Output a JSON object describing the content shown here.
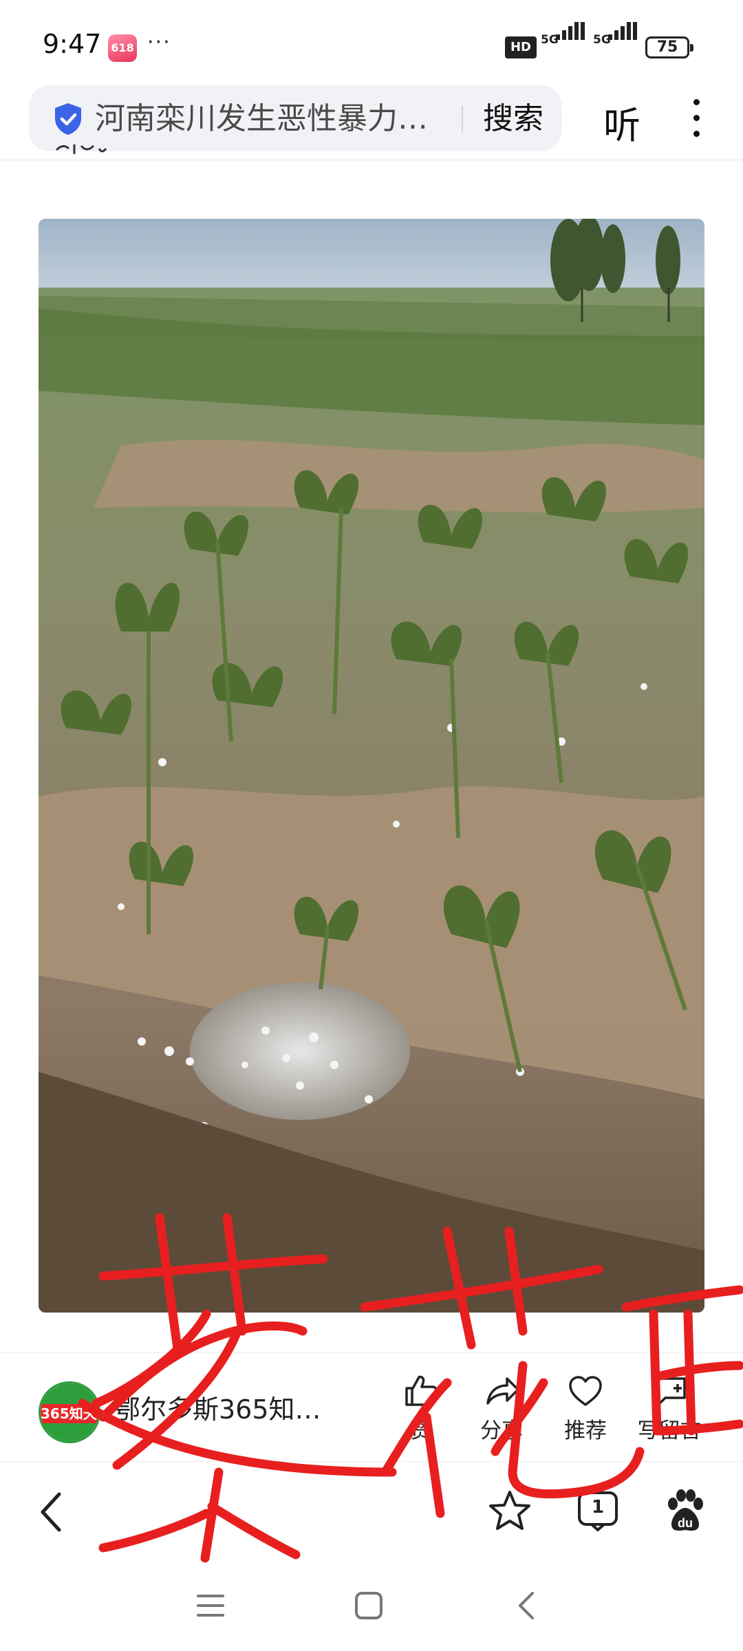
{
  "status_bar": {
    "time": "9:47",
    "app_badge": "618",
    "more_dots": "···",
    "hd_label": "HD",
    "network_1": "5G",
    "network_2": "5G",
    "battery": "75"
  },
  "search": {
    "query": "河南栾川发生恶性暴力…",
    "button_label": "搜索",
    "verified_icon": "shield-check-icon"
  },
  "header": {
    "listen_label": "听",
    "menu_icon": "more-vertical-icon"
  },
  "article": {
    "clipped_line": "",
    "photo_description_icon": "crop-field-hail-photo"
  },
  "author": {
    "name": "鄂尔多斯365知…",
    "avatar_text": "365知天下"
  },
  "actions": [
    {
      "label": "赞",
      "icon": "thumbs-up-icon"
    },
    {
      "label": "分享",
      "icon": "share-icon"
    },
    {
      "label": "推荐",
      "icon": "heart-icon"
    },
    {
      "label": "写留言",
      "icon": "comment-icon"
    }
  ],
  "toolbar": {
    "back_icon": "chevron-left-icon",
    "favorite_icon": "star-icon",
    "tabs_count": "1",
    "baidu_icon": "baidu-paw-icon"
  },
  "colors": {
    "accent_blue": "#3b63e8",
    "scribble_red": "#e81f1f",
    "avatar_green": "#2e9e3d"
  }
}
